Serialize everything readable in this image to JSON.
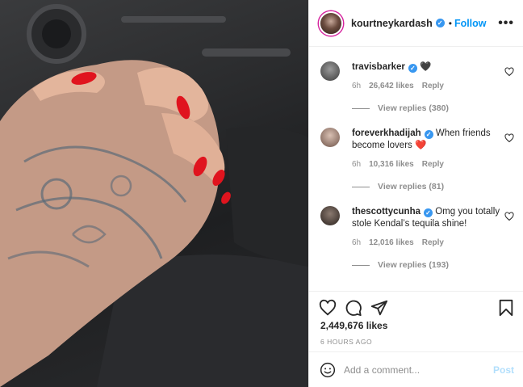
{
  "post": {
    "username": "kourtneykardash",
    "verified_mark": "✓",
    "separator": "•",
    "follow_label": "Follow",
    "more_label": "•••"
  },
  "comments": [
    {
      "username": "travisbarker",
      "text": "🖤",
      "time": "6h",
      "likes": "26,642 likes",
      "reply_label": "Reply",
      "view_replies": "View replies (380)"
    },
    {
      "username": "foreverkhadijah",
      "text": "When friends become lovers ❤️",
      "time": "6h",
      "likes": "10,316 likes",
      "reply_label": "Reply",
      "view_replies": "View replies (81)"
    },
    {
      "username": "thescottycunha",
      "text": "Omg you totally stole Kendal’s tequila shine!",
      "time": "6h",
      "likes": "12,016 likes",
      "reply_label": "Reply",
      "view_replies": "View replies (193)"
    }
  ],
  "actions": {
    "likes_count": "2,449,676 likes",
    "post_time": "6 HOURS AGO"
  },
  "add_comment": {
    "placeholder": "Add a comment...",
    "post_label": "Post"
  },
  "colors": {
    "accent": "#0095f6",
    "verified": "#3897f0",
    "muted": "#8e8e8e",
    "nail": "#e0141e"
  },
  "icons": [
    "verified-icon",
    "heart-icon",
    "comment-icon",
    "share-icon",
    "bookmark-icon",
    "emoji-icon"
  ]
}
